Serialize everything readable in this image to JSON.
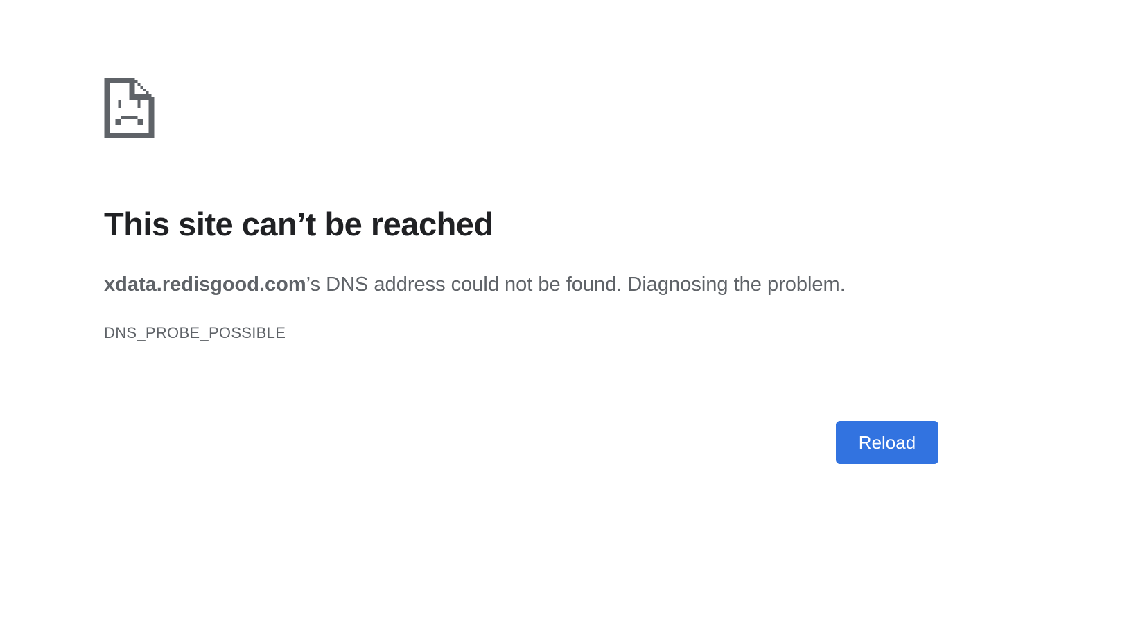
{
  "error": {
    "icon": "sad-page-icon",
    "heading": "This site can’t be reached",
    "host": "xdata.redisgood.com",
    "message_suffix": "’s DNS address could not be found. Diagnosing the problem.",
    "code": "DNS_PROBE_POSSIBLE"
  },
  "actions": {
    "reload_label": "Reload"
  },
  "colors": {
    "background": "#ffffff",
    "heading": "#202124",
    "body_text": "#5f6368",
    "button": "#3273e0",
    "button_text": "#ffffff"
  }
}
